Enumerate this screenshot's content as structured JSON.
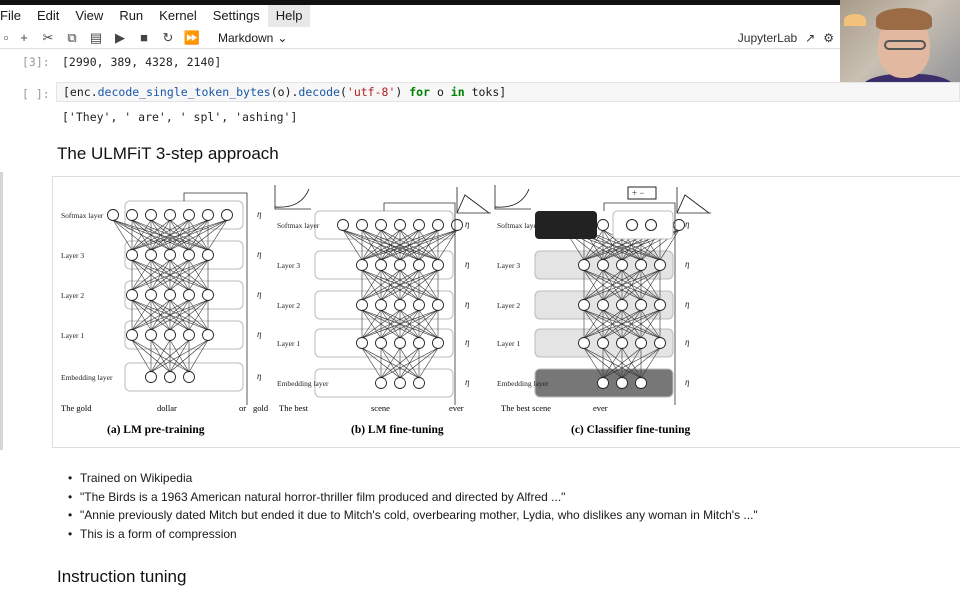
{
  "menu": [
    "File",
    "Edit",
    "View",
    "Run",
    "Kernel",
    "Settings",
    "Help"
  ],
  "toolbar": {
    "cell_type": "Markdown",
    "app_name": "JupyterLab"
  },
  "cells": {
    "out3_prompt": "[3]:",
    "out3_text": "[2990, 389, 4328, 2140]",
    "code_prompt": "[ ]:",
    "code_parts": [
      "[enc.",
      "decode_single_token_bytes",
      "(o).",
      "decode",
      "(",
      "'utf-8'",
      ") ",
      "for",
      " o ",
      "in",
      " toks]"
    ],
    "code_out": "['They', ' are', ' spl', 'ashing']"
  },
  "headings": {
    "ulmfit": "The ULMFiT 3-step approach",
    "instruction": "Instruction tuning"
  },
  "figure": {
    "layer_labels": [
      "Softmax layer",
      "Layer 3",
      "Layer 2",
      "Layer 1",
      "Embedding layer"
    ],
    "eta": "η",
    "panel_a": {
      "caption": "(a) LM pre-training",
      "words": [
        "The gold",
        "dollar",
        "or",
        "gold"
      ]
    },
    "panel_b": {
      "caption": "(b) LM fine-tuning",
      "words": [
        "The best",
        "scene",
        "ever"
      ]
    },
    "panel_c": {
      "caption": "(c) Classifier fine-tuning",
      "words": [
        "The best scene",
        "ever"
      ]
    },
    "plus_minus": "+ −"
  },
  "bullets": [
    "Trained on Wikipedia",
    "\"The Birds is a 1963 American natural horror-thriller film produced and directed by Alfred ...\"",
    "\"Annie previously dated Mitch but ended it due to Mitch's cold, overbearing mother, Lydia, who dislikes any woman in Mitch's ...\"",
    "This is a form of compression"
  ]
}
